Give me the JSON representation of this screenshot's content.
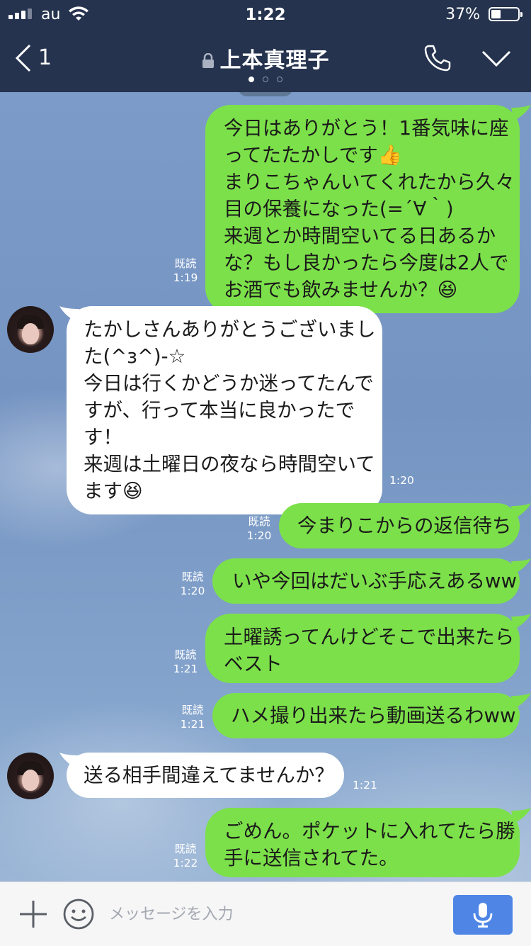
{
  "status_bar": {
    "carrier": "au",
    "time": "1:22",
    "battery": "37%",
    "battery_level": 0.37
  },
  "nav": {
    "back_count": "1",
    "title": "上本真理子",
    "page_indicator": {
      "count": 3,
      "active": 0
    }
  },
  "messages": [
    {
      "side": "me",
      "lines": [
        "今日はありがとう！1番気味に座",
        "ってたたかしです👍",
        "まりこちゃんいてくれたから久々",
        "目の保養になった(=´∀｀)",
        "来週とか時間空いてる日あるか",
        "な？もし良かったら今度は2人で",
        "お酒でも飲みませんか？😆"
      ],
      "read": "既読",
      "time": "1:19"
    },
    {
      "side": "them",
      "lines": [
        "たかしさんありがとうございまし",
        "た(^з^)-☆",
        "今日は行くかどうか迷ってたんで",
        "すが、行って本当に良かったで",
        "す！",
        "来週は土曜日の夜なら時間空いて",
        "ます😆"
      ],
      "time": "1:20"
    },
    {
      "side": "me",
      "lines": [
        "今まりこからの返信待ち"
      ],
      "read": "既読",
      "time": "1:20"
    },
    {
      "side": "me",
      "lines": [
        "いや今回はだいぶ手応えあるww"
      ],
      "read": "既読",
      "time": "1:20"
    },
    {
      "side": "me",
      "lines": [
        "土曜誘ってんけどそこで出来たら",
        "ベスト"
      ],
      "read": "既読",
      "time": "1:21"
    },
    {
      "side": "me",
      "lines": [
        "ハメ撮り出来たら動画送るわww"
      ],
      "read": "既読",
      "time": "1:21"
    },
    {
      "side": "them",
      "lines": [
        "送る相手間違えてませんか？"
      ],
      "time": "1:21"
    },
    {
      "side": "me",
      "lines": [
        "ごめん。ポケットに入れてたら勝",
        "手に送信されてた。"
      ],
      "read": "既読",
      "time": "1:22"
    }
  ],
  "composer": {
    "placeholder": "メッセージを入力"
  },
  "colors": {
    "nav_bg": "#25334e",
    "my_bubble": "#7ce04a",
    "their_bubble": "#ffffff",
    "mic_button": "#4f86e6"
  }
}
